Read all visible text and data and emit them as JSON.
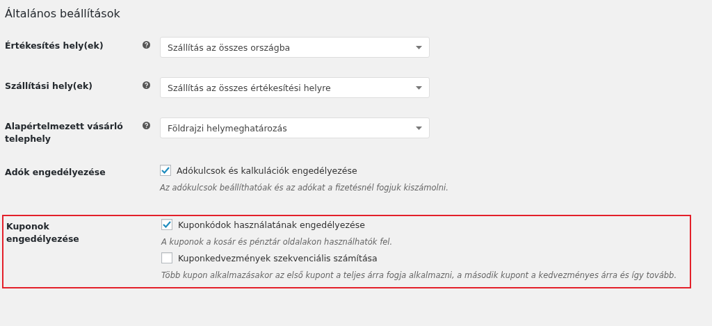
{
  "heading": "Általános beállítások",
  "rows": [
    {
      "kind": "select",
      "label": "Értékesítés hely(ek)",
      "help": true,
      "highlighted": false,
      "value": "Szállítás az összes országba"
    },
    {
      "kind": "select",
      "label": "Szállítási hely(ek)",
      "help": true,
      "highlighted": false,
      "value": "Szállítás az összes értékesítési helyre"
    },
    {
      "kind": "select",
      "label": "Alapértelmezett vásárló telephely",
      "help": true,
      "highlighted": false,
      "value": "Földrajzi helymeghatározás"
    },
    {
      "kind": "checkboxes",
      "label": "Adók engedélyezése",
      "help": false,
      "highlighted": false,
      "options": [
        {
          "label": "Adókulcsok és kalkulációk engedélyezése",
          "checked": true,
          "description": "Az adókulcsok beállíthatóak és az adókat a fizetésnél fogjuk kiszámolni."
        }
      ]
    },
    {
      "kind": "checkboxes",
      "label": "Kuponok engedélyezése",
      "help": false,
      "highlighted": true,
      "options": [
        {
          "label": "Kuponkódok használatának engedélyezése",
          "checked": true,
          "description": "A kuponok a kosár és pénztár oldalakon használhatók fel."
        },
        {
          "label": "Kuponkedvezmények szekvenciális számítása",
          "checked": false,
          "description": "Több kupon alkalmazásakor az első kupont a teljes árra fogja alkalmazni, a második kupont a kedvezményes árra és így tovább."
        }
      ]
    }
  ]
}
